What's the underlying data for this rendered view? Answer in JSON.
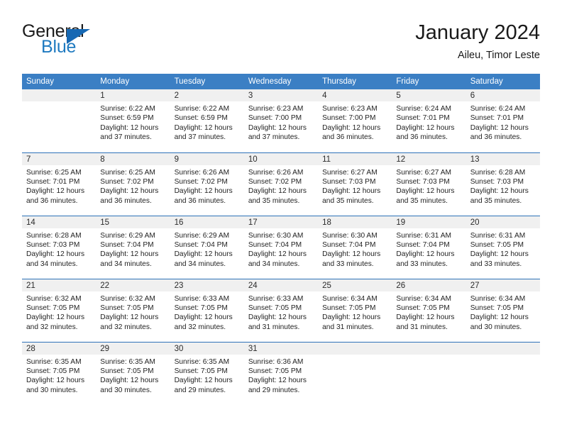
{
  "brand": {
    "word_general": "General",
    "word_blue": "Blue",
    "triangle_color": "#1668b3",
    "blue_color": "#1f7ac0"
  },
  "header": {
    "title": "January 2024",
    "subtitle": "Aileu, Timor Leste",
    "header_bg": "#3b7fc4",
    "row_rule_color": "#2e72b8",
    "daynum_bg": "#f0f0f0"
  },
  "weekdays": [
    "Sunday",
    "Monday",
    "Tuesday",
    "Wednesday",
    "Thursday",
    "Friday",
    "Saturday"
  ],
  "weeks": [
    [
      {
        "day": "",
        "blank": true
      },
      {
        "day": "1",
        "sunrise": "Sunrise: 6:22 AM",
        "sunset": "Sunset: 6:59 PM",
        "daylight": "Daylight: 12 hours and 37 minutes."
      },
      {
        "day": "2",
        "sunrise": "Sunrise: 6:22 AM",
        "sunset": "Sunset: 6:59 PM",
        "daylight": "Daylight: 12 hours and 37 minutes."
      },
      {
        "day": "3",
        "sunrise": "Sunrise: 6:23 AM",
        "sunset": "Sunset: 7:00 PM",
        "daylight": "Daylight: 12 hours and 37 minutes."
      },
      {
        "day": "4",
        "sunrise": "Sunrise: 6:23 AM",
        "sunset": "Sunset: 7:00 PM",
        "daylight": "Daylight: 12 hours and 36 minutes."
      },
      {
        "day": "5",
        "sunrise": "Sunrise: 6:24 AM",
        "sunset": "Sunset: 7:01 PM",
        "daylight": "Daylight: 12 hours and 36 minutes."
      },
      {
        "day": "6",
        "sunrise": "Sunrise: 6:24 AM",
        "sunset": "Sunset: 7:01 PM",
        "daylight": "Daylight: 12 hours and 36 minutes."
      }
    ],
    [
      {
        "day": "7",
        "sunrise": "Sunrise: 6:25 AM",
        "sunset": "Sunset: 7:01 PM",
        "daylight": "Daylight: 12 hours and 36 minutes."
      },
      {
        "day": "8",
        "sunrise": "Sunrise: 6:25 AM",
        "sunset": "Sunset: 7:02 PM",
        "daylight": "Daylight: 12 hours and 36 minutes."
      },
      {
        "day": "9",
        "sunrise": "Sunrise: 6:26 AM",
        "sunset": "Sunset: 7:02 PM",
        "daylight": "Daylight: 12 hours and 36 minutes."
      },
      {
        "day": "10",
        "sunrise": "Sunrise: 6:26 AM",
        "sunset": "Sunset: 7:02 PM",
        "daylight": "Daylight: 12 hours and 35 minutes."
      },
      {
        "day": "11",
        "sunrise": "Sunrise: 6:27 AM",
        "sunset": "Sunset: 7:03 PM",
        "daylight": "Daylight: 12 hours and 35 minutes."
      },
      {
        "day": "12",
        "sunrise": "Sunrise: 6:27 AM",
        "sunset": "Sunset: 7:03 PM",
        "daylight": "Daylight: 12 hours and 35 minutes."
      },
      {
        "day": "13",
        "sunrise": "Sunrise: 6:28 AM",
        "sunset": "Sunset: 7:03 PM",
        "daylight": "Daylight: 12 hours and 35 minutes."
      }
    ],
    [
      {
        "day": "14",
        "sunrise": "Sunrise: 6:28 AM",
        "sunset": "Sunset: 7:03 PM",
        "daylight": "Daylight: 12 hours and 34 minutes."
      },
      {
        "day": "15",
        "sunrise": "Sunrise: 6:29 AM",
        "sunset": "Sunset: 7:04 PM",
        "daylight": "Daylight: 12 hours and 34 minutes."
      },
      {
        "day": "16",
        "sunrise": "Sunrise: 6:29 AM",
        "sunset": "Sunset: 7:04 PM",
        "daylight": "Daylight: 12 hours and 34 minutes."
      },
      {
        "day": "17",
        "sunrise": "Sunrise: 6:30 AM",
        "sunset": "Sunset: 7:04 PM",
        "daylight": "Daylight: 12 hours and 34 minutes."
      },
      {
        "day": "18",
        "sunrise": "Sunrise: 6:30 AM",
        "sunset": "Sunset: 7:04 PM",
        "daylight": "Daylight: 12 hours and 33 minutes."
      },
      {
        "day": "19",
        "sunrise": "Sunrise: 6:31 AM",
        "sunset": "Sunset: 7:04 PM",
        "daylight": "Daylight: 12 hours and 33 minutes."
      },
      {
        "day": "20",
        "sunrise": "Sunrise: 6:31 AM",
        "sunset": "Sunset: 7:05 PM",
        "daylight": "Daylight: 12 hours and 33 minutes."
      }
    ],
    [
      {
        "day": "21",
        "sunrise": "Sunrise: 6:32 AM",
        "sunset": "Sunset: 7:05 PM",
        "daylight": "Daylight: 12 hours and 32 minutes."
      },
      {
        "day": "22",
        "sunrise": "Sunrise: 6:32 AM",
        "sunset": "Sunset: 7:05 PM",
        "daylight": "Daylight: 12 hours and 32 minutes."
      },
      {
        "day": "23",
        "sunrise": "Sunrise: 6:33 AM",
        "sunset": "Sunset: 7:05 PM",
        "daylight": "Daylight: 12 hours and 32 minutes."
      },
      {
        "day": "24",
        "sunrise": "Sunrise: 6:33 AM",
        "sunset": "Sunset: 7:05 PM",
        "daylight": "Daylight: 12 hours and 31 minutes."
      },
      {
        "day": "25",
        "sunrise": "Sunrise: 6:34 AM",
        "sunset": "Sunset: 7:05 PM",
        "daylight": "Daylight: 12 hours and 31 minutes."
      },
      {
        "day": "26",
        "sunrise": "Sunrise: 6:34 AM",
        "sunset": "Sunset: 7:05 PM",
        "daylight": "Daylight: 12 hours and 31 minutes."
      },
      {
        "day": "27",
        "sunrise": "Sunrise: 6:34 AM",
        "sunset": "Sunset: 7:05 PM",
        "daylight": "Daylight: 12 hours and 30 minutes."
      }
    ],
    [
      {
        "day": "28",
        "sunrise": "Sunrise: 6:35 AM",
        "sunset": "Sunset: 7:05 PM",
        "daylight": "Daylight: 12 hours and 30 minutes."
      },
      {
        "day": "29",
        "sunrise": "Sunrise: 6:35 AM",
        "sunset": "Sunset: 7:05 PM",
        "daylight": "Daylight: 12 hours and 30 minutes."
      },
      {
        "day": "30",
        "sunrise": "Sunrise: 6:35 AM",
        "sunset": "Sunset: 7:05 PM",
        "daylight": "Daylight: 12 hours and 29 minutes."
      },
      {
        "day": "31",
        "sunrise": "Sunrise: 6:36 AM",
        "sunset": "Sunset: 7:05 PM",
        "daylight": "Daylight: 12 hours and 29 minutes."
      },
      {
        "day": "",
        "blank": true
      },
      {
        "day": "",
        "blank": true
      },
      {
        "day": "",
        "blank": true
      }
    ]
  ]
}
